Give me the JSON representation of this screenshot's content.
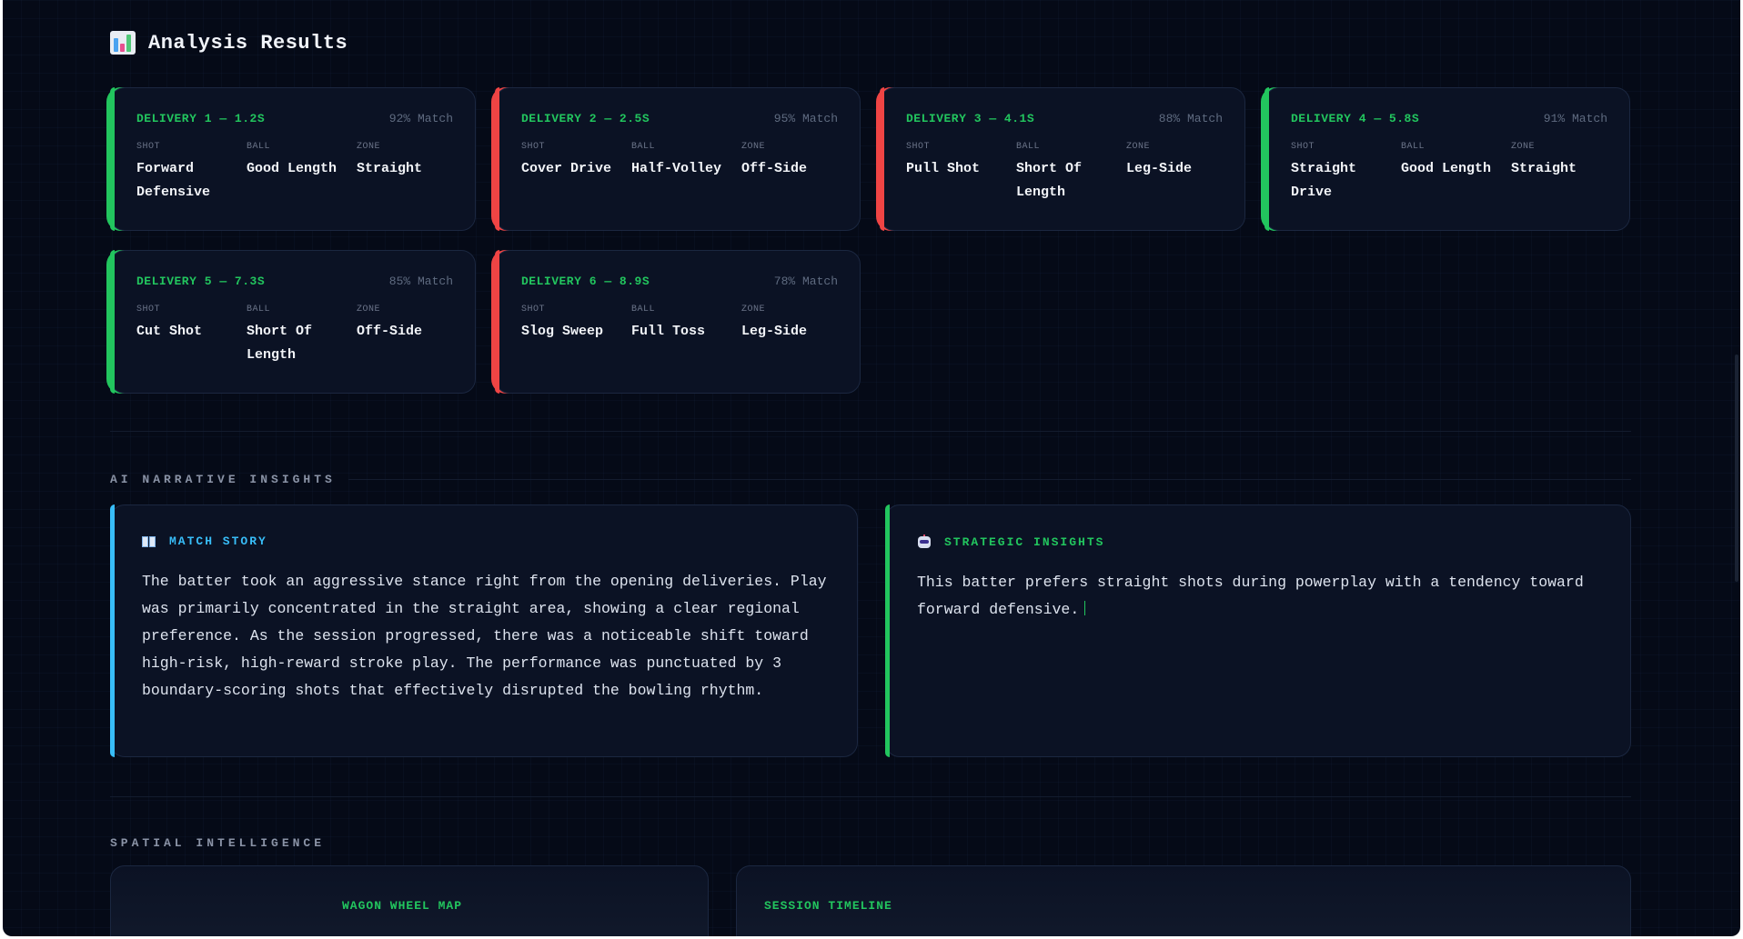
{
  "header": {
    "title": "Analysis Results",
    "icon": "bar-chart-icon"
  },
  "match_suffix": "Match",
  "deliveries": [
    {
      "title": "DELIVERY 1 — 1.2S",
      "match": "92% Match",
      "accent": "#22c55e",
      "shot_label": "SHOT",
      "ball_label": "BALL",
      "zone_label": "ZONE",
      "shot": "Forward Defensive",
      "ball": "Good Length",
      "zone": "Straight"
    },
    {
      "title": "DELIVERY 2 — 2.5S",
      "match": "95% Match",
      "accent": "#ef4444",
      "shot_label": "SHOT",
      "ball_label": "BALL",
      "zone_label": "ZONE",
      "shot": "Cover Drive",
      "ball": "Half-Volley",
      "zone": "Off-Side"
    },
    {
      "title": "DELIVERY 3 — 4.1S",
      "match": "88% Match",
      "accent": "#ef4444",
      "shot_label": "SHOT",
      "ball_label": "BALL",
      "zone_label": "ZONE",
      "shot": "Pull Shot",
      "ball": "Short Of Length",
      "zone": "Leg-Side"
    },
    {
      "title": "DELIVERY 4 — 5.8S",
      "match": "91% Match",
      "accent": "#22c55e",
      "shot_label": "SHOT",
      "ball_label": "BALL",
      "zone_label": "ZONE",
      "shot": "Straight Drive",
      "ball": "Good Length",
      "zone": "Straight"
    },
    {
      "title": "DELIVERY 5 — 7.3S",
      "match": "85% Match",
      "accent": "#22c55e",
      "shot_label": "SHOT",
      "ball_label": "BALL",
      "zone_label": "ZONE",
      "shot": "Cut Shot",
      "ball": "Short Of Length",
      "zone": "Off-Side"
    },
    {
      "title": "DELIVERY 6 — 8.9S",
      "match": "78% Match",
      "accent": "#ef4444",
      "shot_label": "SHOT",
      "ball_label": "BALL",
      "zone_label": "ZONE",
      "shot": "Slog Sweep",
      "ball": "Full Toss",
      "zone": "Leg-Side"
    }
  ],
  "narrative": {
    "heading": "AI NARRATIVE INSIGHTS",
    "match_story": {
      "title": "MATCH STORY",
      "icon": "book-icon",
      "accent": "#38bdf8",
      "body": "The batter took an aggressive stance right from the opening deliveries. Play was primarily concentrated in the straight area, showing a clear regional preference. As the session progressed, there was a noticeable shift toward high-risk, high-reward stroke play. The performance was punctuated by 3 boundary-scoring shots that effectively disrupted the bowling rhythm."
    },
    "strategic": {
      "title": "STRATEGIC INSIGHTS",
      "icon": "robot-icon",
      "accent": "#22c55e",
      "body": "This batter prefers straight shots during powerplay with a tendency toward forward defensive."
    }
  },
  "spatial": {
    "heading": "SPATIAL INTELLIGENCE",
    "wagon_wheel_title": "WAGON WHEEL MAP",
    "timeline_title": "SESSION TIMELINE"
  }
}
